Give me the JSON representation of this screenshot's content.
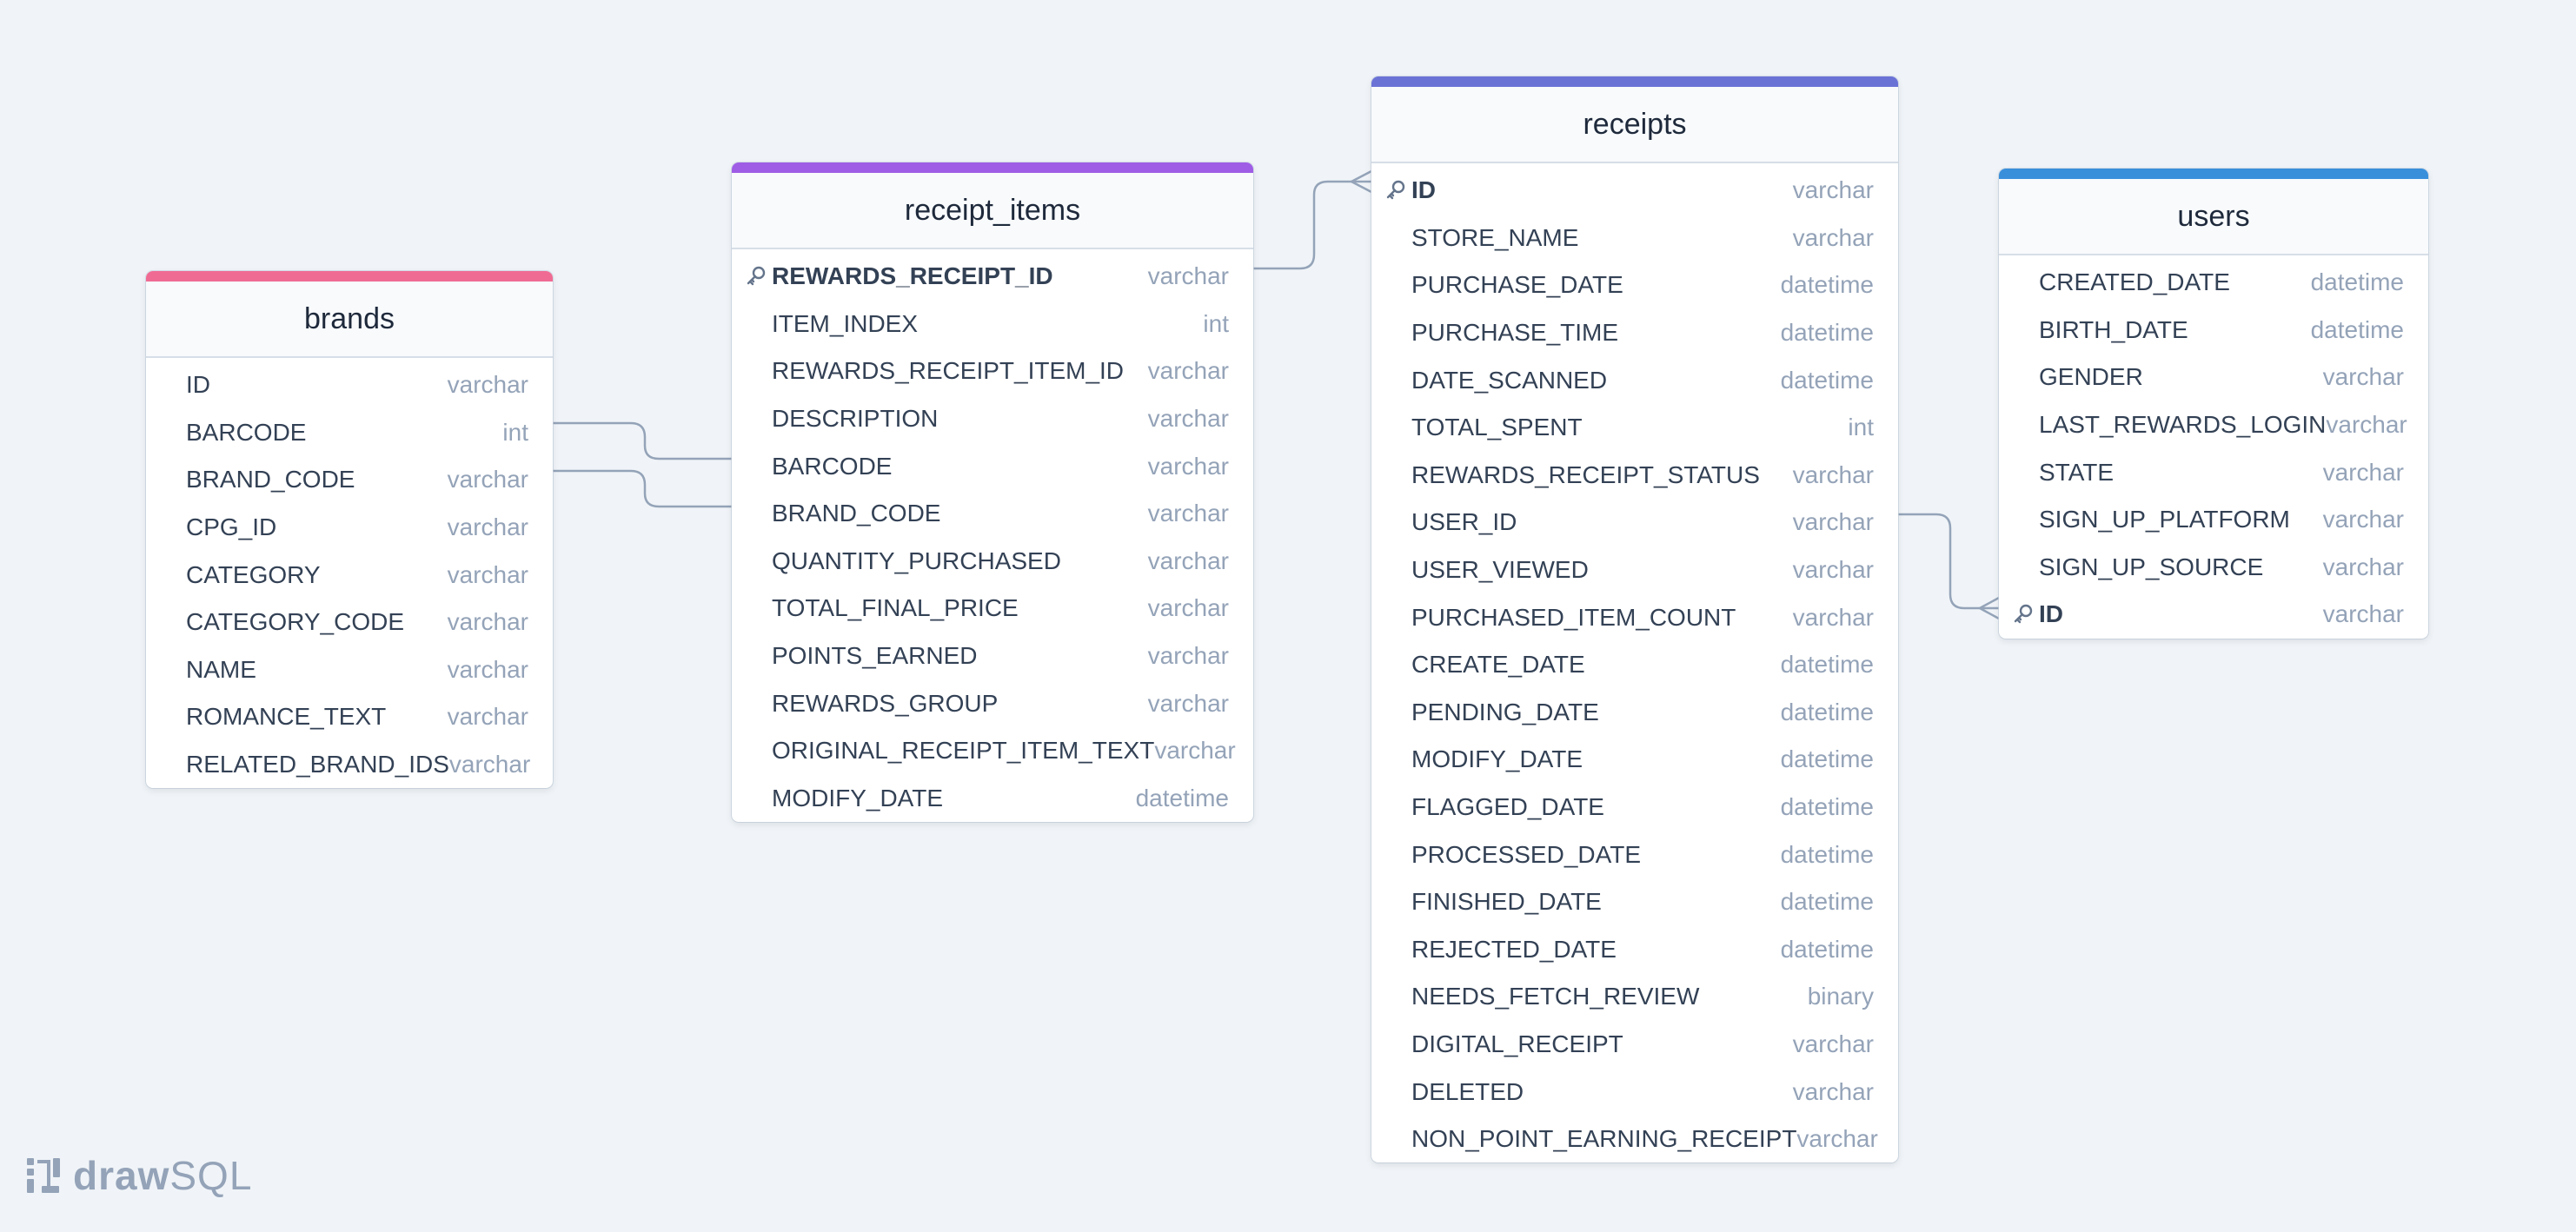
{
  "tables": [
    {
      "name": "brands",
      "color": "#f06b94",
      "columns": [
        {
          "name": "ID",
          "type": "varchar"
        },
        {
          "name": "BARCODE",
          "type": "int"
        },
        {
          "name": "BRAND_CODE",
          "type": "varchar"
        },
        {
          "name": "CPG_ID",
          "type": "varchar"
        },
        {
          "name": "CATEGORY",
          "type": "varchar"
        },
        {
          "name": "CATEGORY_CODE",
          "type": "varchar"
        },
        {
          "name": "NAME",
          "type": "varchar"
        },
        {
          "name": "ROMANCE_TEXT",
          "type": "varchar"
        },
        {
          "name": "RELATED_BRAND_IDS",
          "type": "varchar"
        }
      ]
    },
    {
      "name": "receipt_items",
      "color": "#9f5de6",
      "columns": [
        {
          "name": "REWARDS_RECEIPT_ID",
          "type": "varchar",
          "pk": true
        },
        {
          "name": "ITEM_INDEX",
          "type": "int"
        },
        {
          "name": "REWARDS_RECEIPT_ITEM_ID",
          "type": "varchar"
        },
        {
          "name": "DESCRIPTION",
          "type": "varchar"
        },
        {
          "name": "BARCODE",
          "type": "varchar"
        },
        {
          "name": "BRAND_CODE",
          "type": "varchar"
        },
        {
          "name": "QUANTITY_PURCHASED",
          "type": "varchar"
        },
        {
          "name": "TOTAL_FINAL_PRICE",
          "type": "varchar"
        },
        {
          "name": "POINTS_EARNED",
          "type": "varchar"
        },
        {
          "name": "REWARDS_GROUP",
          "type": "varchar"
        },
        {
          "name": "ORIGINAL_RECEIPT_ITEM_TEXT",
          "type": "varchar"
        },
        {
          "name": "MODIFY_DATE",
          "type": "datetime"
        }
      ]
    },
    {
      "name": "receipts",
      "color": "#6b72d6",
      "columns": [
        {
          "name": "ID",
          "type": "varchar",
          "pk": true
        },
        {
          "name": "STORE_NAME",
          "type": "varchar"
        },
        {
          "name": "PURCHASE_DATE",
          "type": "datetime"
        },
        {
          "name": "PURCHASE_TIME",
          "type": "datetime"
        },
        {
          "name": "DATE_SCANNED",
          "type": "datetime"
        },
        {
          "name": "TOTAL_SPENT",
          "type": "int"
        },
        {
          "name": "REWARDS_RECEIPT_STATUS",
          "type": "varchar"
        },
        {
          "name": "USER_ID",
          "type": "varchar"
        },
        {
          "name": "USER_VIEWED",
          "type": "varchar"
        },
        {
          "name": "PURCHASED_ITEM_COUNT",
          "type": "varchar"
        },
        {
          "name": "CREATE_DATE",
          "type": "datetime"
        },
        {
          "name": "PENDING_DATE",
          "type": "datetime"
        },
        {
          "name": "MODIFY_DATE",
          "type": "datetime"
        },
        {
          "name": "FLAGGED_DATE",
          "type": "datetime"
        },
        {
          "name": "PROCESSED_DATE",
          "type": "datetime"
        },
        {
          "name": "FINISHED_DATE",
          "type": "datetime"
        },
        {
          "name": "REJECTED_DATE",
          "type": "datetime"
        },
        {
          "name": "NEEDS_FETCH_REVIEW",
          "type": "binary"
        },
        {
          "name": "DIGITAL_RECEIPT",
          "type": "varchar"
        },
        {
          "name": "DELETED",
          "type": "varchar"
        },
        {
          "name": "NON_POINT_EARNING_RECEIPT",
          "type": "varchar"
        }
      ]
    },
    {
      "name": "users",
      "color": "#3a8fdb",
      "columns": [
        {
          "name": "CREATED_DATE",
          "type": "datetime"
        },
        {
          "name": "BIRTH_DATE",
          "type": "datetime"
        },
        {
          "name": "GENDER",
          "type": "varchar"
        },
        {
          "name": "LAST_REWARDS_LOGIN",
          "type": "varchar"
        },
        {
          "name": "STATE",
          "type": "varchar"
        },
        {
          "name": "SIGN_UP_PLATFORM",
          "type": "varchar"
        },
        {
          "name": "SIGN_UP_SOURCE",
          "type": "varchar"
        },
        {
          "name": "ID",
          "type": "varchar",
          "pk": true
        }
      ]
    }
  ],
  "relationships": [
    {
      "from": "brands.BARCODE",
      "to": "receipt_items.BARCODE",
      "end": "one"
    },
    {
      "from": "brands.BRAND_CODE",
      "to": "receipt_items.BRAND_CODE",
      "end": "one"
    },
    {
      "from": "receipt_items.REWARDS_RECEIPT_ID",
      "to": "receipts.ID",
      "end": "many"
    },
    {
      "from": "receipts.USER_ID",
      "to": "users.ID",
      "end": "many"
    }
  ],
  "branding": {
    "word_bold": "draw",
    "word_light": "SQL"
  },
  "colors": {
    "connector": "#94a3b8",
    "background": "#f0f4f8"
  }
}
